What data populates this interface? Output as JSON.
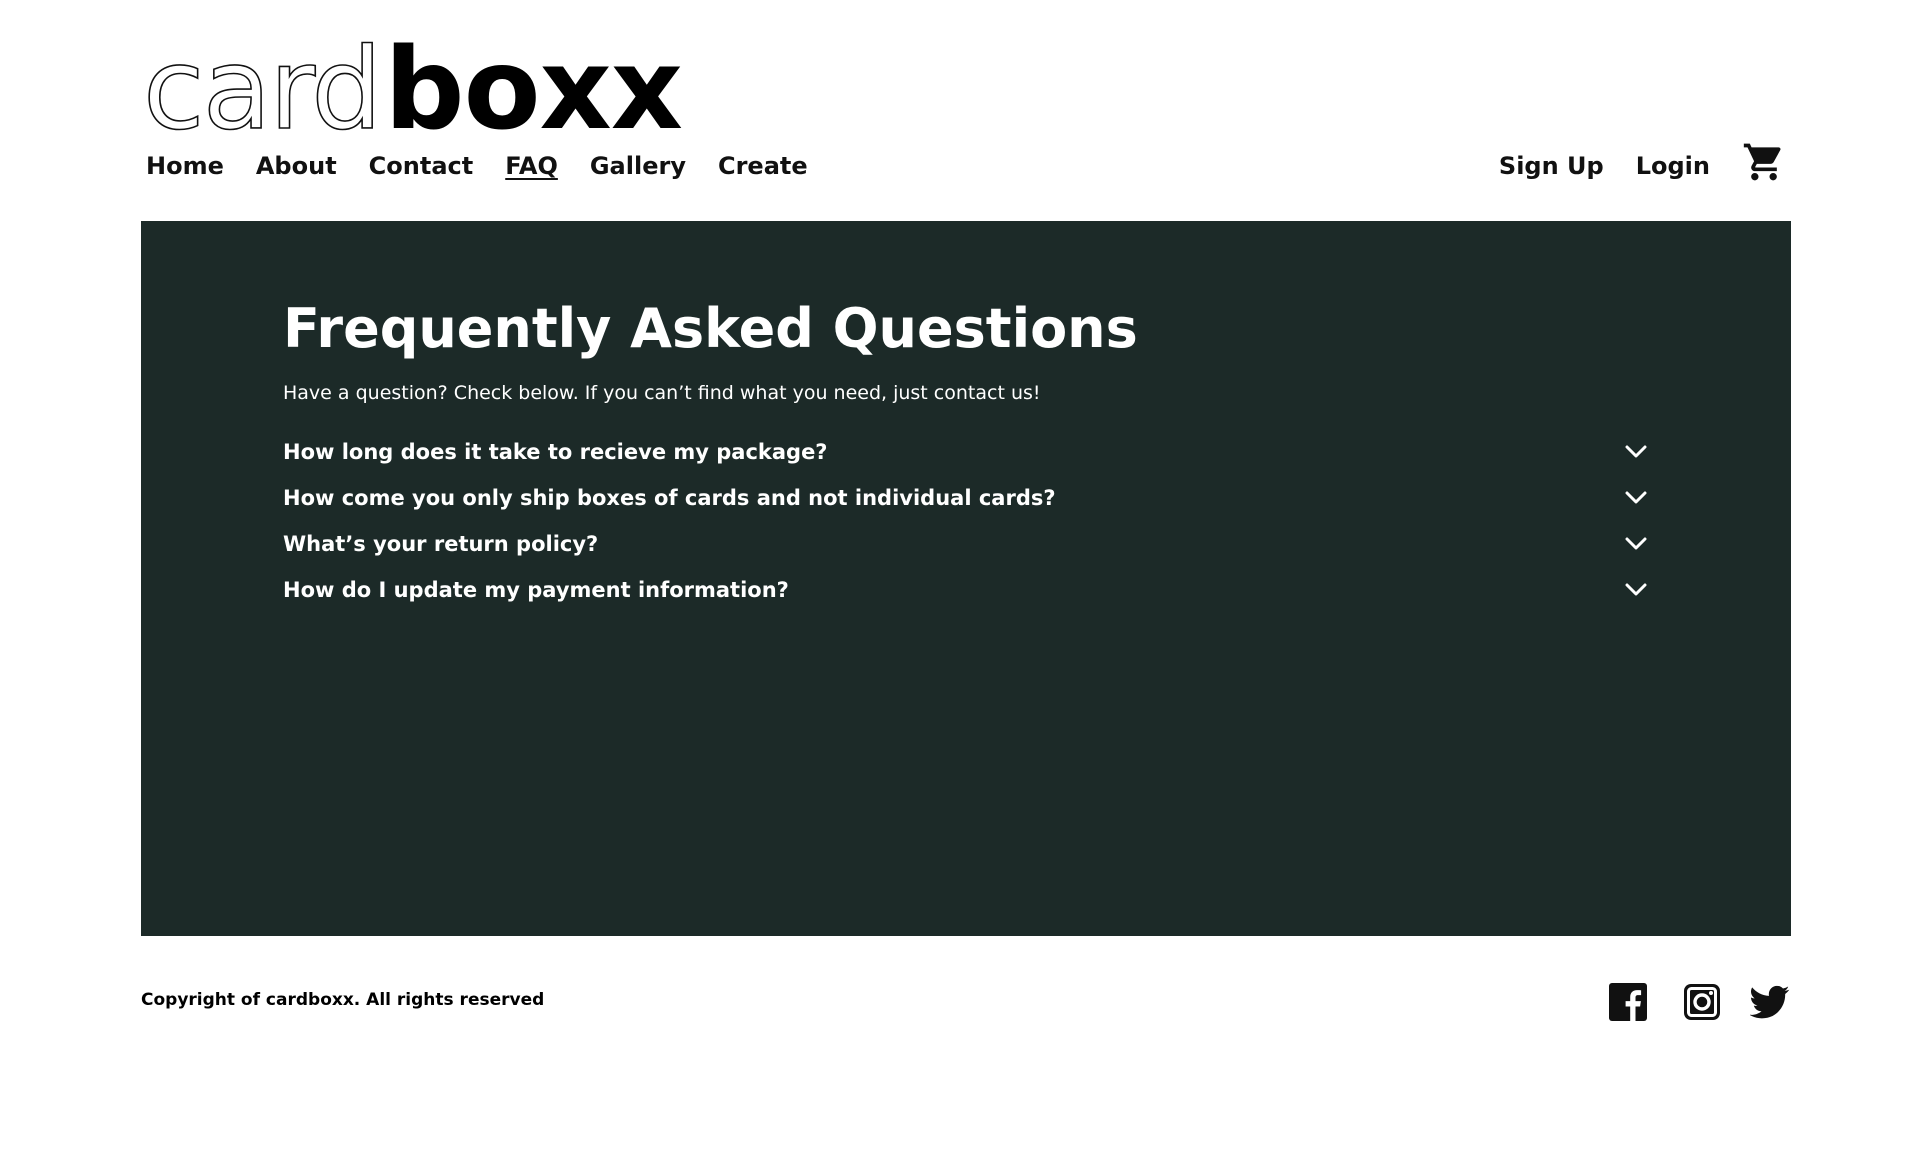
{
  "logo": {
    "part1": "card",
    "part2": "boxx"
  },
  "nav": {
    "left": [
      {
        "label": "Home"
      },
      {
        "label": "About"
      },
      {
        "label": "Contact"
      },
      {
        "label": "FAQ",
        "active": true
      },
      {
        "label": "Gallery"
      },
      {
        "label": "Create"
      }
    ],
    "right": [
      {
        "label": "Sign Up"
      },
      {
        "label": "Login"
      }
    ],
    "cart_icon": "shopping-cart-icon"
  },
  "faq": {
    "title": "Frequently Asked Questions",
    "subtitle": "Have a question? Check below. If you can’t find what you need, just contact us!",
    "items": [
      {
        "question": "How long does it take to recieve my package?"
      },
      {
        "question": "How come you only ship boxes of cards and not individual cards?"
      },
      {
        "question": "What’s your return policy?"
      },
      {
        "question": "How do I update my payment information?"
      }
    ]
  },
  "footer": {
    "copyright": "Copyright of cardboxx. All rights reserved",
    "social": [
      "facebook-icon",
      "instagram-icon",
      "twitter-icon"
    ]
  },
  "colors": {
    "panel": "#1c2a28",
    "text_dark": "#111111",
    "text_light": "#ffffff"
  }
}
